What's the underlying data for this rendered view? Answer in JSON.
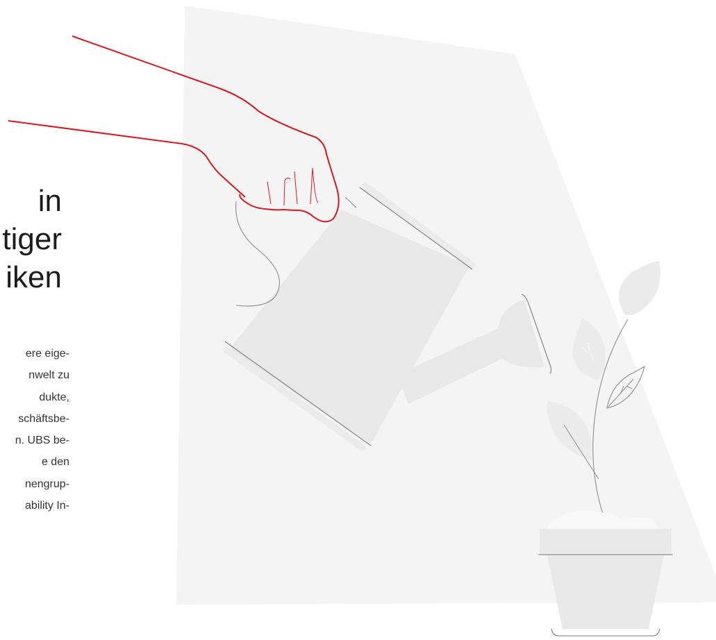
{
  "headline_lines": [
    "in",
    "tiger",
    "iken"
  ],
  "body_lines": [
    "ere eige-",
    "nwelt zu",
    "dukte,",
    "schäftsbe-",
    "n. UBS be-",
    "e den",
    "nengrup-",
    "ability In-"
  ],
  "colors": {
    "background_panel": "#f4f4f4",
    "accent_red": "#e0141c",
    "line_gray": "#8c8c8c",
    "object_fill": "#e8e8e8"
  }
}
